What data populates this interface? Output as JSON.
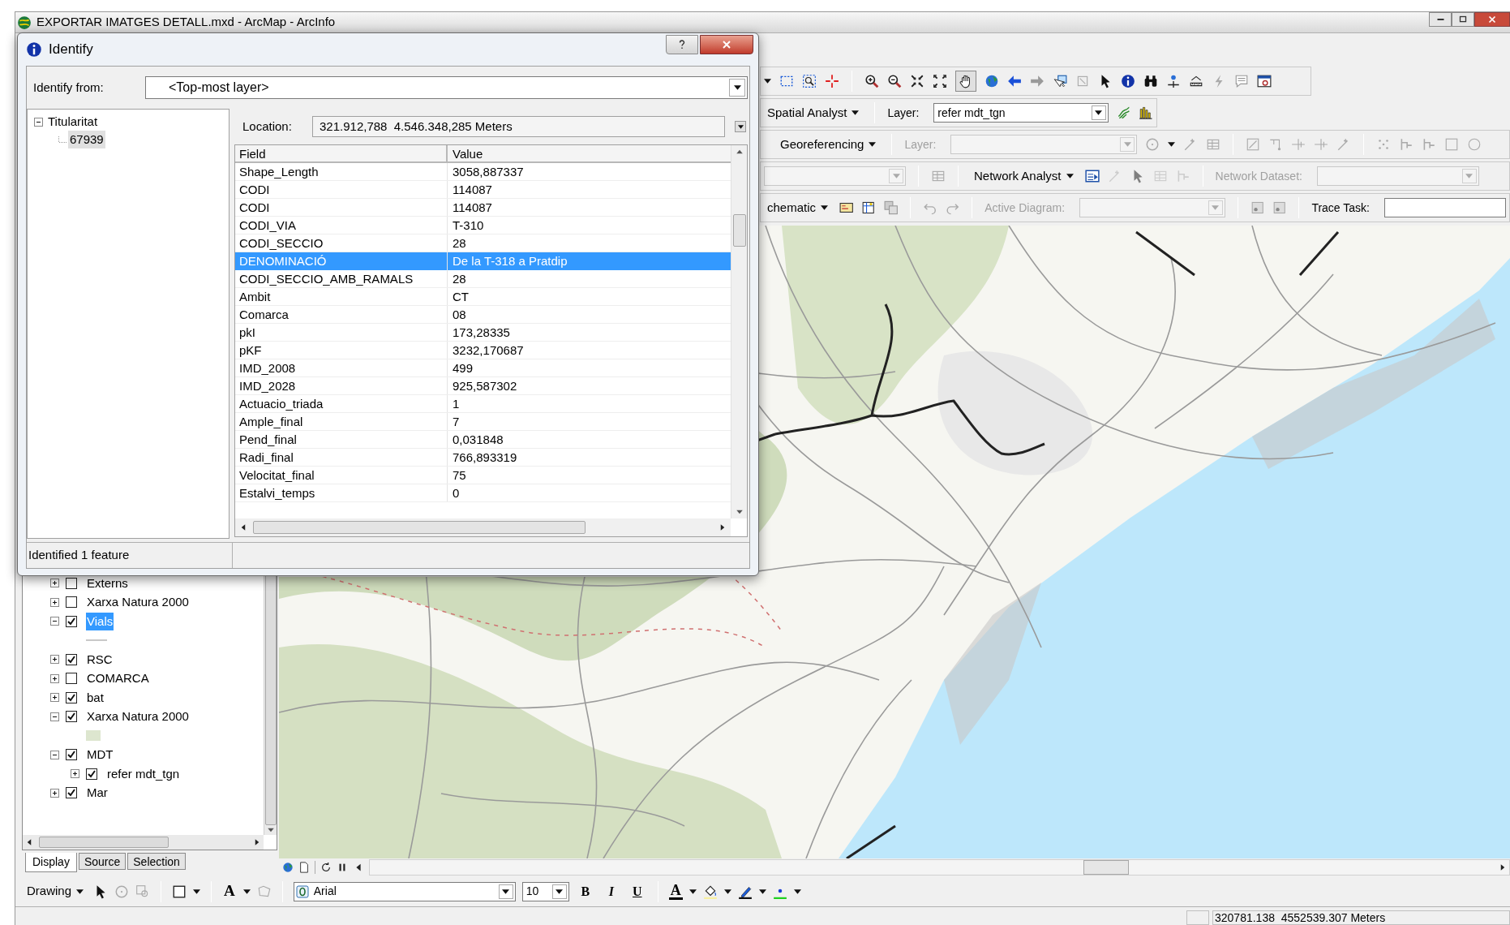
{
  "window": {
    "title": "EXPORTAR IMATGES DETALL.mxd - ArcMap - ArcInfo"
  },
  "toolbars": {
    "spatial_analyst": {
      "menu": "Spatial Analyst",
      "layer_label": {
        "text": "Layer:",
        "disabled": false
      },
      "layer_value": "refer mdt_tgn"
    },
    "georeferencing": {
      "menu": "Georeferencing",
      "layer_label": {
        "text": "Layer:",
        "disabled": true
      }
    },
    "network_analyst": {
      "menu": "Network Analyst",
      "dataset_label": {
        "text": "Network Dataset:",
        "disabled": true
      }
    },
    "schematic": {
      "menu": "chematic",
      "diagram_label": {
        "text": "Active Diagram:",
        "disabled": true
      }
    },
    "utility_network": {
      "trace_task_label": {
        "text": "Trace Task:",
        "disabled": false
      }
    }
  },
  "identify": {
    "title": "Identify",
    "from_label": "Identify from:",
    "from_value": "<Top-most layer>",
    "tree": [
      {
        "label": "Titularitat",
        "expanded": true,
        "selected": false,
        "children": [
          {
            "label": "67939",
            "selected": true
          }
        ]
      }
    ],
    "location_label": "Location:",
    "location_value": "321.912,788  4.546.348,285 Meters",
    "columns": [
      "Field",
      "Value"
    ],
    "rows": [
      {
        "field": "Shape_Length",
        "value": "3058,887337",
        "selected": false
      },
      {
        "field": "CODI",
        "value": "114087",
        "selected": false
      },
      {
        "field": "CODI",
        "value": "114087",
        "selected": false
      },
      {
        "field": "CODI_VIA",
        "value": "T-310",
        "selected": false
      },
      {
        "field": "CODI_SECCIO",
        "value": "28",
        "selected": false
      },
      {
        "field": "DENOMINACIÓ",
        "value": "De la T-318 a Pratdip",
        "selected": true
      },
      {
        "field": "CODI_SECCIO_AMB_RAMALS",
        "value": "28",
        "selected": false
      },
      {
        "field": "Ambit",
        "value": "CT",
        "selected": false
      },
      {
        "field": "Comarca",
        "value": "08",
        "selected": false
      },
      {
        "field": "pkI",
        "value": "173,28335",
        "selected": false
      },
      {
        "field": "pKF",
        "value": "3232,170687",
        "selected": false
      },
      {
        "field": "IMD_2008",
        "value": "499",
        "selected": false
      },
      {
        "field": "IMD_2028",
        "value": "925,587302",
        "selected": false
      },
      {
        "field": "Actuacio_triada",
        "value": "1",
        "selected": false
      },
      {
        "field": "Ample_final",
        "value": "7",
        "selected": false
      },
      {
        "field": "Pend_final",
        "value": "0,031848",
        "selected": false
      },
      {
        "field": "Radi_final",
        "value": "766,893319",
        "selected": false
      },
      {
        "field": "Velocitat_final",
        "value": "75",
        "selected": false
      },
      {
        "field": "Estalvi_temps",
        "value": "0",
        "selected": false
      }
    ],
    "status": "Identified 1 feature"
  },
  "toc": {
    "layers": [
      {
        "kind": "layer",
        "label": "Externs",
        "checked": false,
        "expanded": false,
        "selected": false
      },
      {
        "kind": "layer",
        "label": "Xarxa Natura 2000",
        "checked": false,
        "expanded": false,
        "selected": false
      },
      {
        "kind": "layer",
        "label": "Vials",
        "checked": true,
        "expanded": true,
        "selected": true,
        "children": [
          {
            "kind": "line-symbol",
            "color": "#c8c8c8"
          }
        ]
      },
      {
        "kind": "layer",
        "label": "RSC",
        "checked": true,
        "expanded": false,
        "selected": false
      },
      {
        "kind": "layer",
        "label": "COMARCA",
        "checked": false,
        "expanded": false,
        "selected": false
      },
      {
        "kind": "layer",
        "label": "bat",
        "checked": true,
        "expanded": false,
        "selected": false
      },
      {
        "kind": "layer",
        "label": "Xarxa Natura 2000",
        "checked": true,
        "expanded": true,
        "selected": false,
        "children": [
          {
            "kind": "fill-symbol",
            "color": "#dde6cf"
          }
        ]
      },
      {
        "kind": "layer",
        "label": "MDT",
        "checked": true,
        "expanded": true,
        "selected": false,
        "children": [
          {
            "kind": "layer",
            "label": "refer mdt_tgn",
            "checked": true,
            "expanded": false,
            "selected": false
          }
        ]
      },
      {
        "kind": "layer",
        "label": "Mar",
        "checked": true,
        "expanded": false,
        "selected": false
      }
    ],
    "tabs": [
      {
        "label": "Display",
        "selected": true
      },
      {
        "label": "Source",
        "selected": false
      },
      {
        "label": "Selection",
        "selected": false
      }
    ]
  },
  "drawing_toolbar": {
    "menu": "Drawing",
    "text_tool": "A",
    "font": "Arial",
    "size": "10",
    "bold": "B",
    "italic": "I",
    "underline": "U",
    "font_color": "A"
  },
  "status_bar": {
    "coordinates": "320781.138  4552539.307 Meters"
  }
}
